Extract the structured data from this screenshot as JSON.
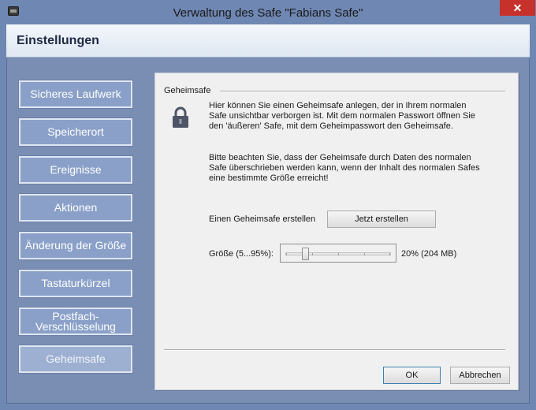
{
  "window": {
    "title": "Verwaltung des Safe \"Fabians Safe\"",
    "close_glyph": "✕",
    "app_icon": "safe-icon"
  },
  "header": {
    "title": "Einstellungen"
  },
  "nav": {
    "items": [
      {
        "label": "Sicheres Laufwerk"
      },
      {
        "label": "Speicherort"
      },
      {
        "label": "Ereignisse"
      },
      {
        "label": "Aktionen"
      },
      {
        "label": "Änderung der Größe"
      },
      {
        "label": "Tastaturkürzel"
      },
      {
        "label": "Postfach-\nVerschlüsselung"
      },
      {
        "label": "Geheimsafe"
      }
    ],
    "active": "Geheimsafe"
  },
  "panel": {
    "group_label": "Geheimsafe",
    "icon": "lock-icon",
    "description_1": "Hier können Sie einen Geheimsafe anlegen, der in Ihrem normalen Safe unsichtbar verborgen ist. Mit dem normalen Passwort öffnen Sie den 'äußeren' Safe, mit dem Geheimpasswort den Geheimsafe.",
    "description_2": "Bitte beachten Sie, dass der Geheimsafe durch Daten des normalen Safe überschrieben werden kann, wenn der Inhalt des normalen Safes eine bestimmte Größe erreicht!",
    "create_label": "Einen Geheimsafe erstellen",
    "create_button": "Jetzt erstellen",
    "size_label": "Größe (5...95%):",
    "size_percent": 20,
    "size_min": 5,
    "size_max": 95,
    "size_value_text": "20% (204 MB)"
  },
  "buttons": {
    "ok": "OK",
    "cancel": "Abbrechen"
  },
  "colors": {
    "frame": "#6f87b3",
    "nav_button": "#8aa0c8",
    "close_button": "#c7312b",
    "panel": "#f0f0f0"
  }
}
